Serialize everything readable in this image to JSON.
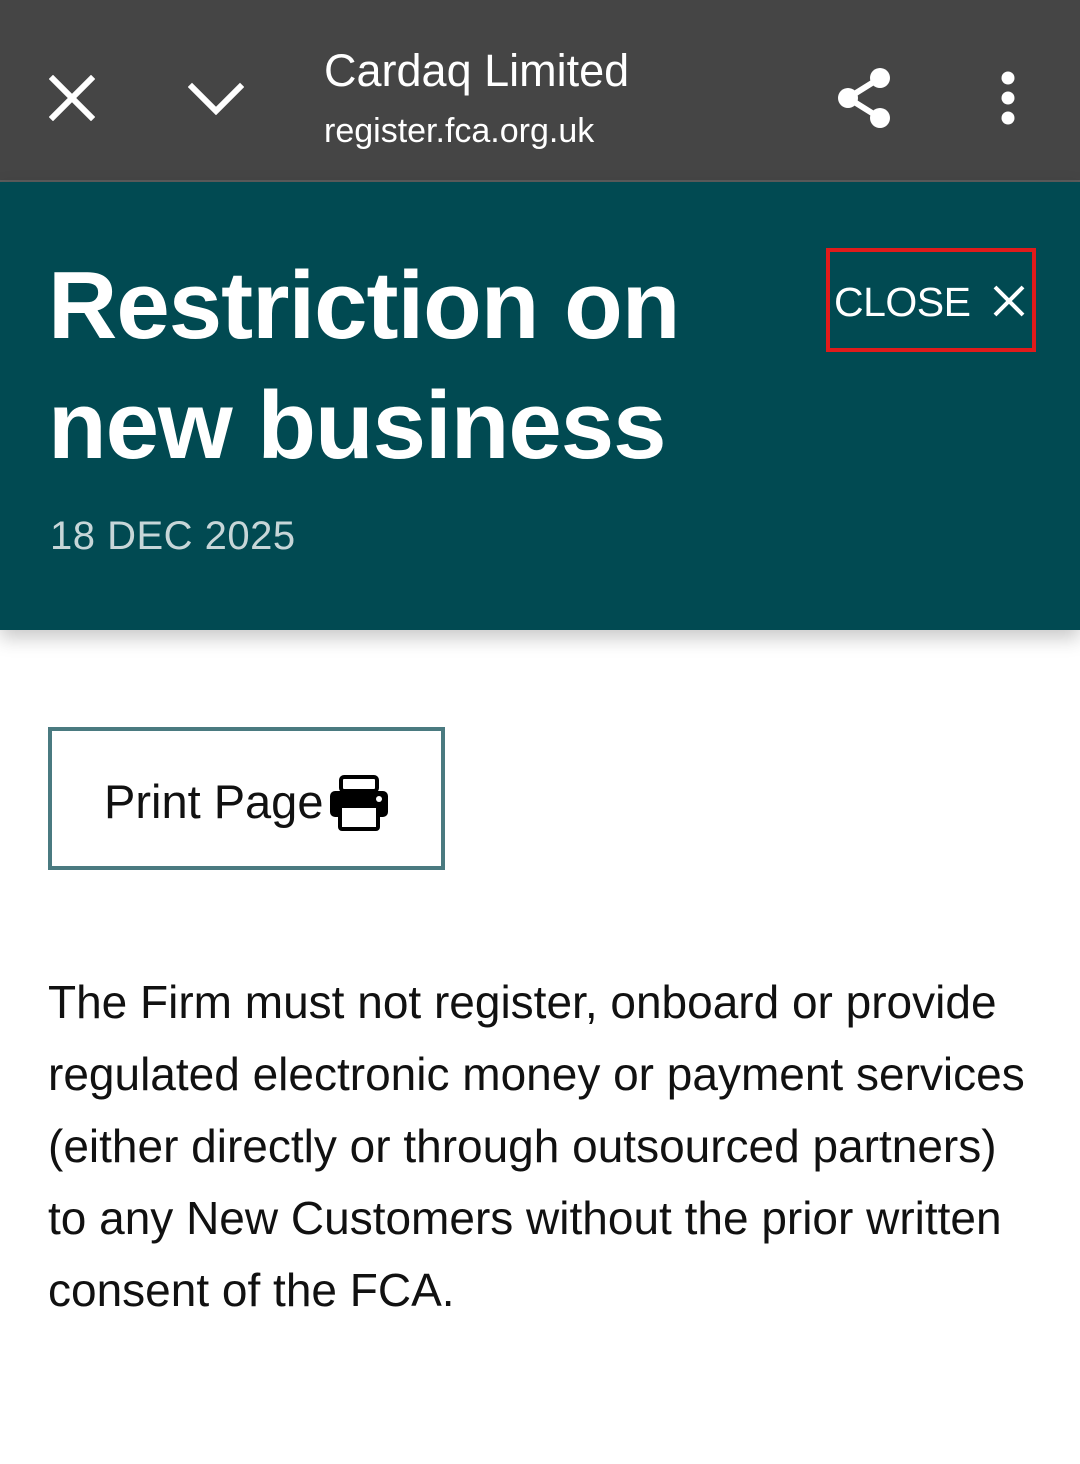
{
  "toolbar": {
    "title": "Cardaq Limited",
    "url": "register.fca.org.uk",
    "icons": {
      "close": "close-icon",
      "minimize": "chevron-down-icon",
      "share": "share-icon",
      "more": "more-vert-icon"
    }
  },
  "panel": {
    "title": "Restriction on new business",
    "date": "18 DEC 2025",
    "close_label": "CLOSE",
    "background": "#014a52"
  },
  "print": {
    "label": "Print Page",
    "icon": "printer-icon",
    "border_color": "#4a7a80"
  },
  "body": {
    "text": "The Firm must not register, onboard or provide regulated electronic money or payment services (either directly or through outsourced partners) to any New Customers without the prior written consent of the FCA."
  },
  "colors": {
    "toolbar": "#454545",
    "highlight": "#e01b1b"
  }
}
